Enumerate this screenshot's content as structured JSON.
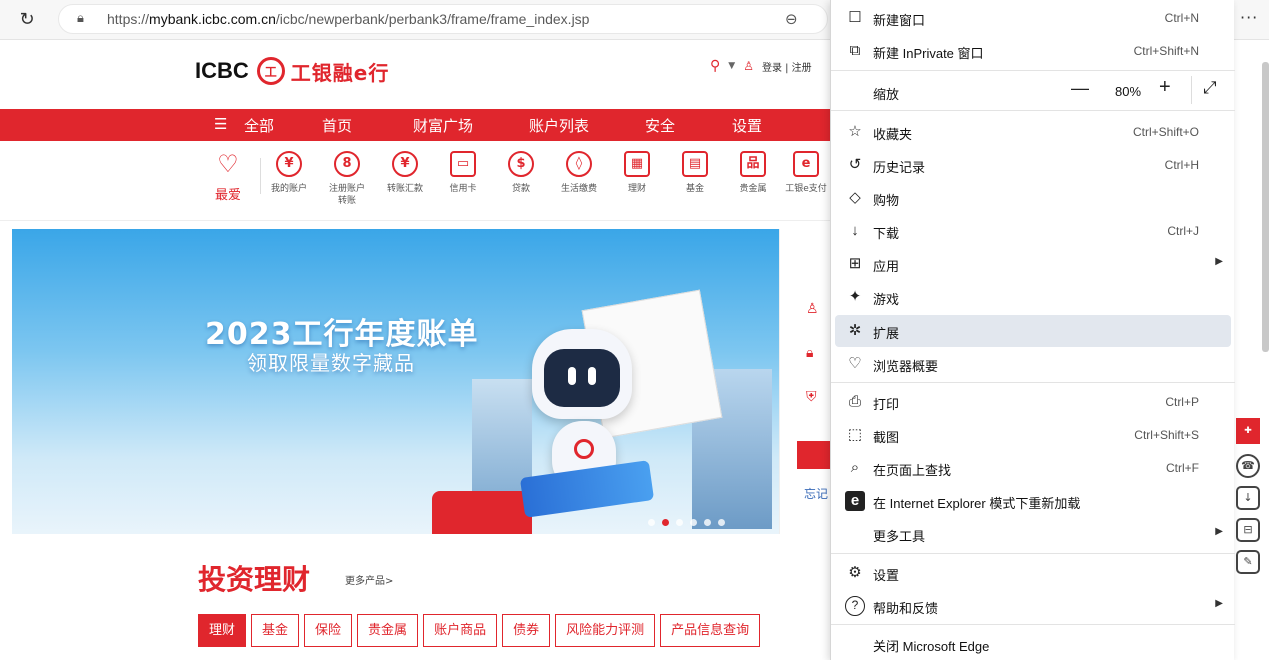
{
  "browser": {
    "url_prefix": "https://",
    "url_domain": "mybank.icbc.com.cn",
    "url_path": "/icbc/newperbank/perbank3/frame/frame_index.jsp"
  },
  "header": {
    "logo_text": "ICBC",
    "logo_cn": "工银融e行",
    "login_text": "登录 | 注册"
  },
  "nav": [
    "全部",
    "首页",
    "财富广场",
    "账户列表",
    "安全",
    "设置"
  ],
  "favorites_label": "最爱",
  "quick_icons": [
    {
      "label": "我的账户",
      "glyph": "¥"
    },
    {
      "label": "注册账户转账",
      "glyph": "8"
    },
    {
      "label": "转账汇款",
      "glyph": "¥"
    },
    {
      "label": "信用卡",
      "glyph": "▭"
    },
    {
      "label": "贷款",
      "glyph": "$"
    },
    {
      "label": "生活缴费",
      "glyph": "◊"
    },
    {
      "label": "理财",
      "glyph": "▦"
    },
    {
      "label": "基金",
      "glyph": "▤"
    },
    {
      "label": "贵金属",
      "glyph": "品"
    },
    {
      "label": "工银e支付",
      "glyph": "e"
    }
  ],
  "banner": {
    "headline": "2023工行年度账单",
    "subline": "领取限量数字藏品"
  },
  "login_panel": {
    "forgot": "忘记"
  },
  "invest": {
    "title": "投资理财",
    "more": "更多产品>",
    "tabs": [
      "理财",
      "基金",
      "保险",
      "贵金属",
      "账户商品",
      "债券",
      "风险能力评测",
      "产品信息查询"
    ]
  },
  "menu": {
    "items": [
      {
        "id": "new-window",
        "icon": "☐",
        "label": "新建窗口",
        "shortcut": "Ctrl+N"
      },
      {
        "id": "new-inprivate",
        "icon": "⧉",
        "label": "新建 InPrivate 窗口",
        "shortcut": "Ctrl+Shift+N"
      },
      {
        "id": "zoom",
        "label": "缩放"
      },
      {
        "id": "favorites",
        "icon": "☆",
        "label": "收藏夹",
        "shortcut": "Ctrl+Shift+O"
      },
      {
        "id": "history",
        "icon": "↺",
        "label": "历史记录",
        "shortcut": "Ctrl+H"
      },
      {
        "id": "shopping",
        "icon": "◇",
        "label": "购物",
        "shortcut": ""
      },
      {
        "id": "downloads",
        "icon": "↓",
        "label": "下载",
        "shortcut": "Ctrl+J"
      },
      {
        "id": "apps",
        "icon": "⊞",
        "label": "应用",
        "shortcut": ""
      },
      {
        "id": "games",
        "icon": "✦",
        "label": "游戏",
        "shortcut": ""
      },
      {
        "id": "extensions",
        "icon": "✲",
        "label": "扩展",
        "shortcut": ""
      },
      {
        "id": "browser-essentials",
        "icon": "♡",
        "label": "浏览器概要",
        "shortcut": ""
      },
      {
        "id": "print",
        "icon": "⎙",
        "label": "打印",
        "shortcut": "Ctrl+P"
      },
      {
        "id": "screenshot",
        "icon": "⬚",
        "label": "截图",
        "shortcut": "Ctrl+Shift+S"
      },
      {
        "id": "find",
        "icon": "⌕",
        "label": "在页面上查找",
        "shortcut": "Ctrl+F"
      },
      {
        "id": "ie-mode",
        "icon": "e",
        "label": "在 Internet Explorer 模式下重新加载",
        "shortcut": ""
      },
      {
        "id": "more-tools",
        "icon": "",
        "label": "更多工具",
        "shortcut": ""
      },
      {
        "id": "settings",
        "icon": "⚙",
        "label": "设置",
        "shortcut": ""
      },
      {
        "id": "help",
        "icon": "?",
        "label": "帮助和反馈",
        "shortcut": ""
      },
      {
        "id": "close-edge",
        "icon": "",
        "label": "关闭 Microsoft Edge",
        "shortcut": ""
      }
    ],
    "zoom_value": "80%"
  },
  "colors": {
    "brand_red": "#e0262d",
    "menu_highlight": "#e2e7ee"
  }
}
